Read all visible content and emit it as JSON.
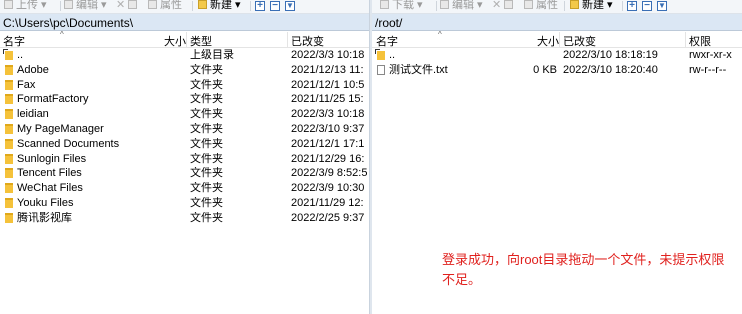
{
  "left": {
    "toolbar": {
      "upload": "上传",
      "edit": "编辑",
      "properties": "属性",
      "new": "新建"
    },
    "path": "C:\\Users\\pc\\Documents\\",
    "columns": {
      "name": "名字",
      "size": "大小",
      "type": "类型",
      "modified": "已改变"
    },
    "rows": [
      {
        "name": "..",
        "size": "",
        "type": "上级目录",
        "modified": "2022/3/3  10:18",
        "icon": "up-folder-icon"
      },
      {
        "name": "Adobe",
        "size": "",
        "type": "文件夹",
        "modified": "2021/12/13  11:",
        "icon": "folder-icon"
      },
      {
        "name": "Fax",
        "size": "",
        "type": "文件夹",
        "modified": "2021/12/1  10:5",
        "icon": "folder-icon"
      },
      {
        "name": "FormatFactory",
        "size": "",
        "type": "文件夹",
        "modified": "2021/11/25  15:",
        "icon": "folder-icon"
      },
      {
        "name": "leidian",
        "size": "",
        "type": "文件夹",
        "modified": "2022/3/3  10:18",
        "icon": "folder-icon"
      },
      {
        "name": "My PageManager",
        "size": "",
        "type": "文件夹",
        "modified": "2022/3/10  9:37",
        "icon": "folder-icon"
      },
      {
        "name": "Scanned Documents",
        "size": "",
        "type": "文件夹",
        "modified": "2021/12/1  17:1",
        "icon": "folder-icon"
      },
      {
        "name": "Sunlogin Files",
        "size": "",
        "type": "文件夹",
        "modified": "2021/12/29  16:",
        "icon": "folder-icon"
      },
      {
        "name": "Tencent Files",
        "size": "",
        "type": "文件夹",
        "modified": "2022/3/9  8:52:5",
        "icon": "folder-icon"
      },
      {
        "name": "WeChat Files",
        "size": "",
        "type": "文件夹",
        "modified": "2022/3/9  10:30",
        "icon": "folder-icon"
      },
      {
        "name": "Youku Files",
        "size": "",
        "type": "文件夹",
        "modified": "2021/11/29  12:",
        "icon": "folder-icon"
      },
      {
        "name": "腾讯影视库",
        "size": "",
        "type": "文件夹",
        "modified": "2022/2/25  9:37",
        "icon": "folder-icon"
      }
    ]
  },
  "right": {
    "toolbar": {
      "download": "下载",
      "edit": "编辑",
      "properties": "属性",
      "new": "新建"
    },
    "path": "/root/",
    "columns": {
      "name": "名字",
      "size": "大小",
      "modified": "已改变",
      "permissions": "权限"
    },
    "rows": [
      {
        "name": "..",
        "size": "",
        "modified": "2022/3/10 18:18:19",
        "permissions": "rwxr-xr-x",
        "icon": "up-folder-icon"
      },
      {
        "name": "测试文件.txt",
        "size": "0 KB",
        "modified": "2022/3/10 18:20:40",
        "permissions": "rw-r--r--",
        "icon": "file-icon"
      }
    ]
  },
  "annotation": "登录成功，向root目录拖动一个文件，未提示权限不足。"
}
